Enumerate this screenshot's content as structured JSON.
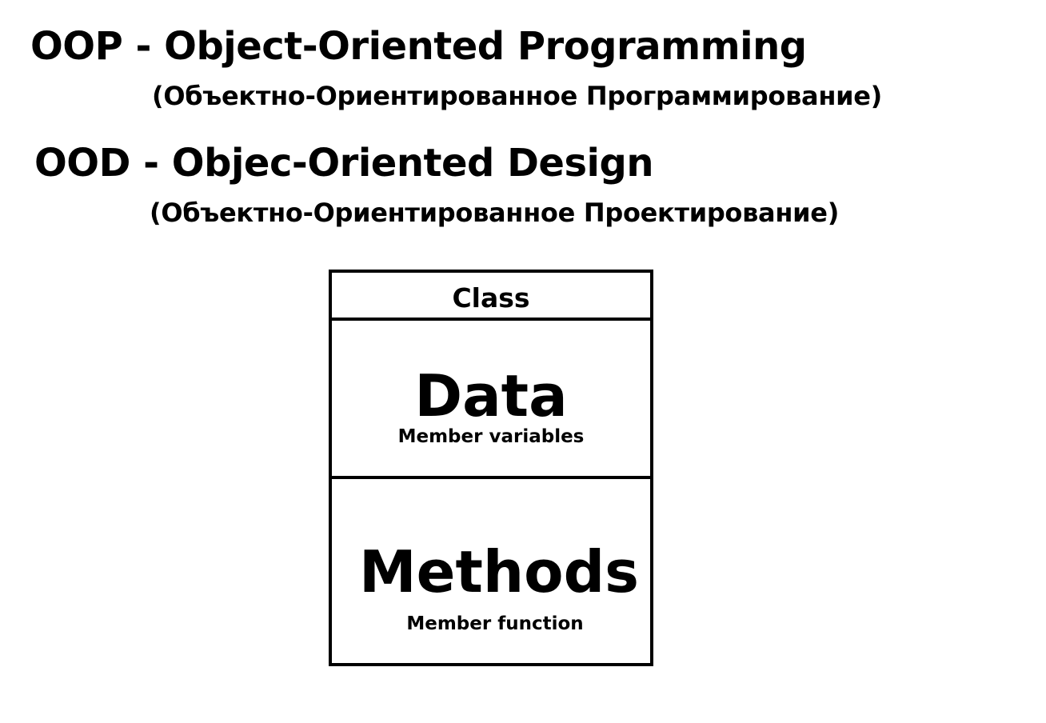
{
  "oop": {
    "heading": "OOP - Object-Oriented Programming",
    "translation": "(Объектно-Ориентированное Программирование)"
  },
  "ood": {
    "heading": "OOD - Objec-Oriented Design",
    "translation": "(Объектно-Ориентированное Проектирование)"
  },
  "class_diagram": {
    "title": "Class",
    "data": {
      "label": "Data",
      "sublabel": "Member variables"
    },
    "methods": {
      "label": "Methods",
      "sublabel": "Member function"
    }
  }
}
